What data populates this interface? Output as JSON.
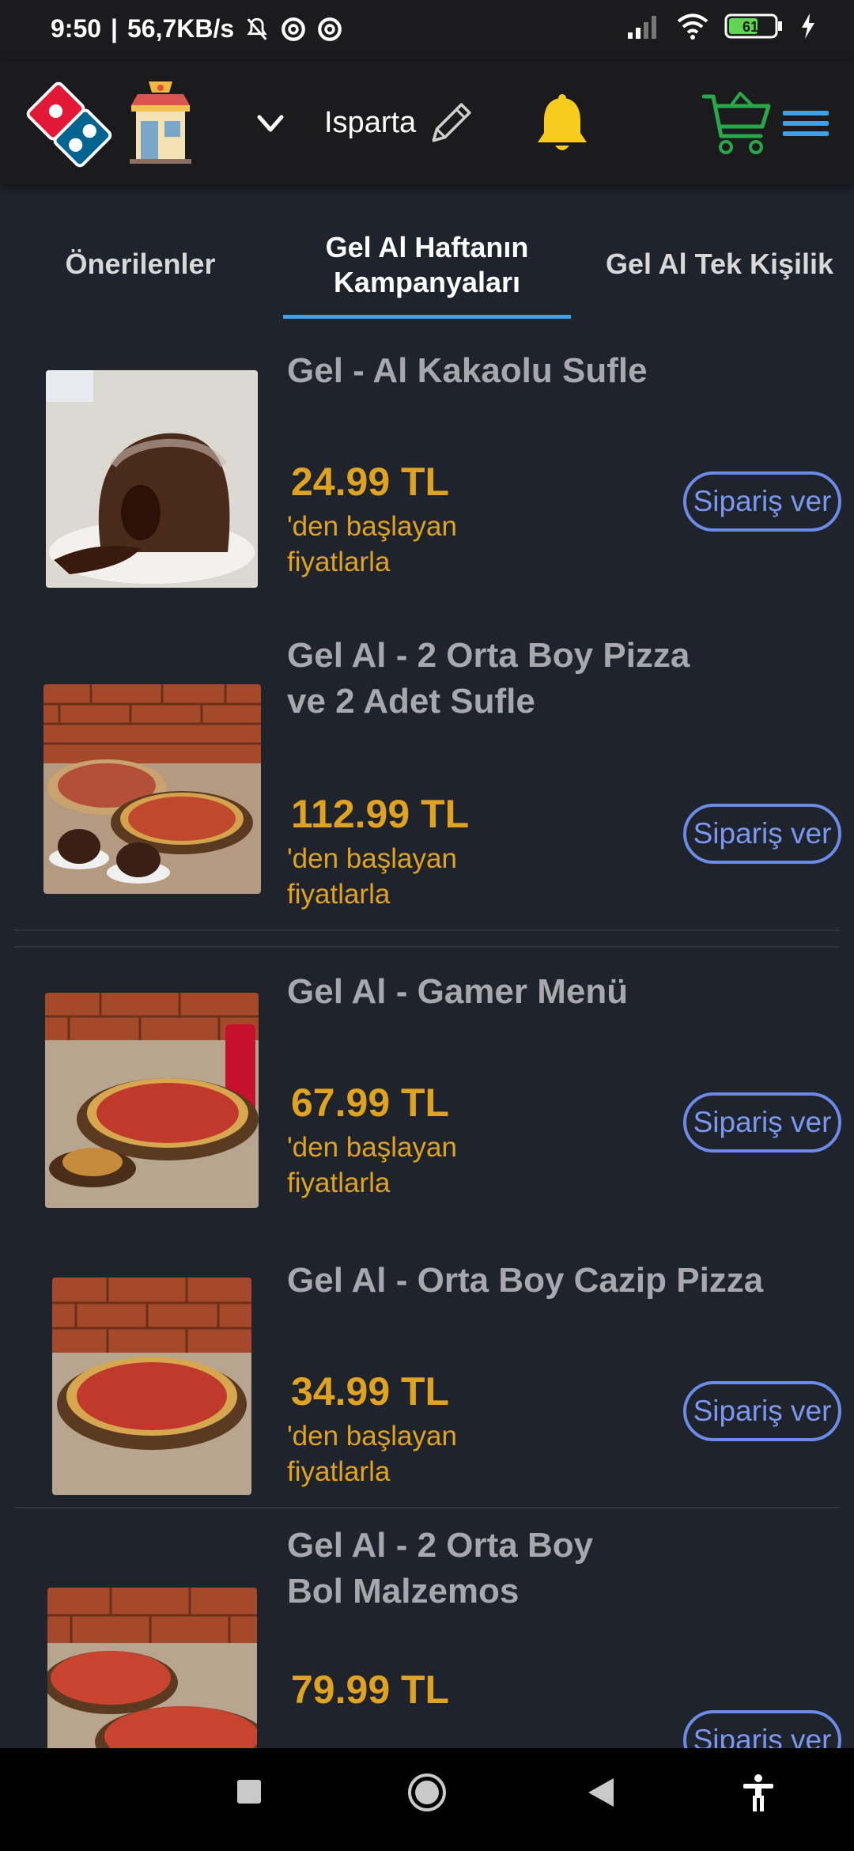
{
  "status_bar": {
    "time": "9:50",
    "speed": "56,7KB/s",
    "battery": "61",
    "icons": [
      "mute-bell-icon",
      "circle-a-icon",
      "circle-a-icon",
      "signal-icon",
      "wifi-icon",
      "battery-icon",
      "charging-icon"
    ]
  },
  "header": {
    "city": "Isparta",
    "icons": [
      "dominos-logo",
      "store-icon",
      "chevron-down-icon",
      "pencil-icon",
      "bell-icon",
      "cart-icon",
      "menu-icon"
    ]
  },
  "tabs": [
    {
      "label": "Önerilenler"
    },
    {
      "label": "Gel Al Haftanın\nKampanyaları"
    },
    {
      "label": "Gel Al Tek Kişilik"
    }
  ],
  "products": [
    {
      "title": "Gel - Al Kakaolu Sufle",
      "price": "24.99 TL",
      "sub": "'den başlayan\n fiyatlarla",
      "button": "Sipariş ver"
    },
    {
      "title": "Gel Al - 2 Orta Boy Pizza\n ve 2 Adet Sufle",
      "price": "112.99 TL",
      "sub": " 'den başlayan\n  fiyatlarla",
      "button": "Sipariş ver"
    },
    {
      "title": "Gel Al - Gamer Menü",
      "price": "67.99 TL",
      "sub": "'den başlayan\n fiyatlarla",
      "button": "Sipariş ver"
    },
    {
      "title": "Gel Al - Orta Boy Cazip Pizza",
      "price": "34.99 TL",
      "sub": "'den başlayan\n fiyatlarla",
      "button": "Sipariş ver"
    },
    {
      "title": "Gel Al - 2 Orta Boy\nBol Malzemos",
      "price": "79.99 TL",
      "sub": "",
      "button": "Sipariş ver"
    }
  ],
  "colors": {
    "background": "#1f232c",
    "price": "#e0a321",
    "button": "#6c8ae8",
    "tab_indicator": "#3fa0ea",
    "bell": "#f7cc1c",
    "cart": "#29a84a"
  }
}
